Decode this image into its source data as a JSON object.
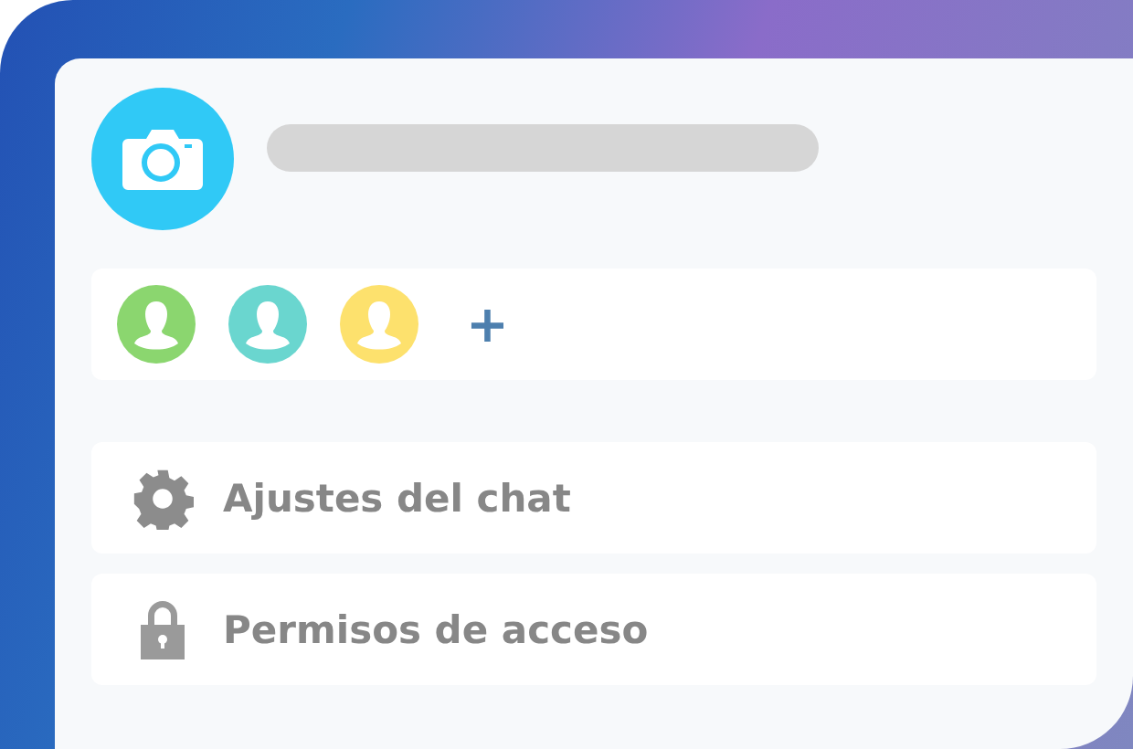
{
  "members": [
    {
      "color": "#8bd66f"
    },
    {
      "color": "#6ad6cf"
    },
    {
      "color": "#fde16d"
    }
  ],
  "add_member": "+",
  "menu": [
    {
      "kind": "settings",
      "label": "Ajustes del chat"
    },
    {
      "kind": "lock",
      "label": "Permisos de acceso"
    }
  ]
}
